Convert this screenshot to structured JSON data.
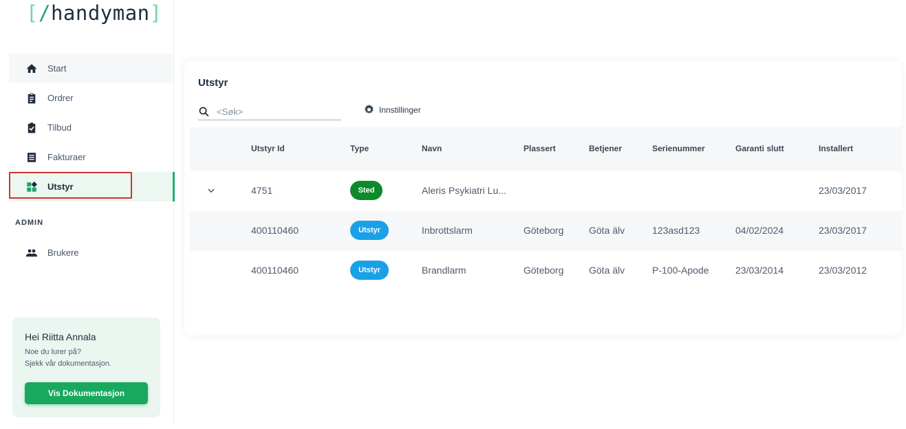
{
  "logo": {
    "open": "[",
    "slash": "/",
    "word": "handyman",
    "close": "]"
  },
  "nav": [
    {
      "label": "Start",
      "icon": "home-icon"
    },
    {
      "label": "Ordrer",
      "icon": "clipboard-icon"
    },
    {
      "label": "Tilbud",
      "icon": "clipboard-check-icon"
    },
    {
      "label": "Fakturaer",
      "icon": "document-list-icon"
    },
    {
      "label": "Utstyr",
      "icon": "dashboard-icon"
    }
  ],
  "admin": {
    "section_label": "ADMIN",
    "items": [
      {
        "label": "Brukere",
        "icon": "users-icon"
      }
    ]
  },
  "help": {
    "title": "Hei Riitta Annala",
    "line1": "Noe du lurer på?",
    "line2": "Sjekk vår dokumentasjon.",
    "button": "Vis Dokumentasjon"
  },
  "main": {
    "title": "Utstyr",
    "search_placeholder": "<Søk>",
    "settings_label": "Innstillinger",
    "columns": [
      "Utstyr Id",
      "Type",
      "Navn",
      "Plassert",
      "Betjener",
      "Serienummer",
      "Garanti slutt",
      "Installert"
    ],
    "rows": [
      {
        "id": "4751",
        "type": "Sted",
        "name": "Aleris Psykiatri Lu...",
        "plassert": "",
        "betjener": "",
        "serial": "",
        "garanti": "",
        "installert": "23/03/2017"
      },
      {
        "id": "400110460",
        "type": "Utstyr",
        "name": "Inbrottslarm",
        "plassert": "Göteborg",
        "betjener": "Göta älv",
        "serial": "123asd123",
        "garanti": "04/02/2024",
        "installert": "23/03/2017"
      },
      {
        "id": "400110460",
        "type": "Utstyr",
        "name": "Brandlarm",
        "plassert": "Göteborg",
        "betjener": "Göta älv",
        "serial": "P-100-Apode",
        "garanti": "23/03/2014",
        "installert": "23/03/2012"
      }
    ]
  },
  "colors": {
    "accent": "#21ad6a",
    "sted_badge": "#0d8a2b",
    "utstyr_badge": "#1aa0e8",
    "highlight": "#d53030"
  }
}
